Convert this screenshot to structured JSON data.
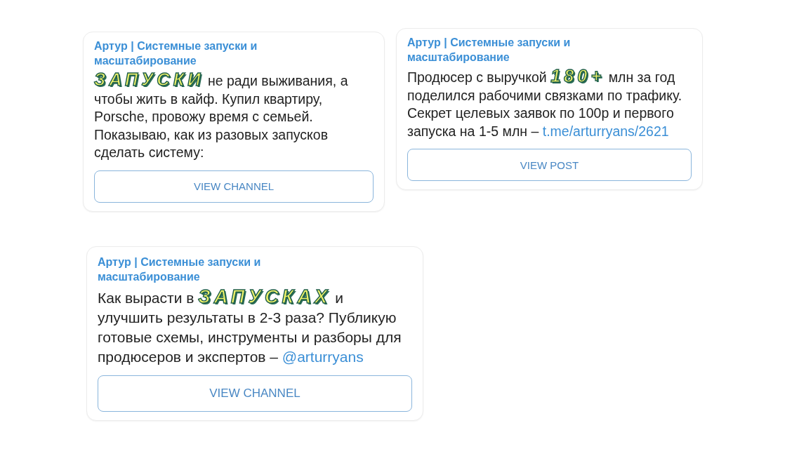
{
  "cards": [
    {
      "channel": "Артур | Системные запуски и масштабирование",
      "message": [
        {
          "kind": "emoji",
          "text": "ЗАПУСКИ"
        },
        {
          "kind": "plain",
          "text": " не ради выживания, а чтобы жить в кайф. Купил квартиру, Porsche, провожу время с семьей. Показываю, как из разовых запусков сделать систему:"
        }
      ],
      "button": "VIEW CHANNEL"
    },
    {
      "channel": "Артур | Системные запуски и масштабирование",
      "message": [
        {
          "kind": "plain",
          "text": "Продюсер с выручкой "
        },
        {
          "kind": "emoji",
          "text": "180+"
        },
        {
          "kind": "plain",
          "text": " млн за год поделился рабочими связками по трафику. Секрет целевых заявок по 100р и первого запуска на 1-5 млн – "
        },
        {
          "kind": "link",
          "text": "t.me/arturryans/2621"
        }
      ],
      "button": "VIEW POST"
    },
    {
      "channel": "Артур | Системные запуски и масштабирование",
      "message": [
        {
          "kind": "plain",
          "text": "Как вырасти в "
        },
        {
          "kind": "emoji",
          "text": "ЗАПУСКАХ"
        },
        {
          "kind": "plain",
          "text": " и улучшить результаты в 2-3 раза? Публикую готовые схемы, инструменты и разборы для продюсеров и экспертов – "
        },
        {
          "kind": "link",
          "text": "@arturryans"
        }
      ],
      "button": "VIEW CHANNEL"
    }
  ]
}
